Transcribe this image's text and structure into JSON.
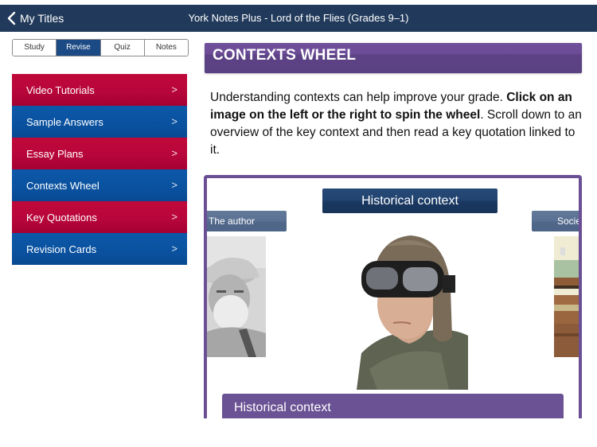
{
  "navbar": {
    "back_label": "My Titles",
    "title": "York Notes Plus - Lord of the Flies (Grades 9–1)"
  },
  "segments": [
    {
      "label": "Study",
      "active": false
    },
    {
      "label": "Revise",
      "active": true
    },
    {
      "label": "Quiz",
      "active": false
    },
    {
      "label": "Notes",
      "active": false
    }
  ],
  "menu": {
    "items": [
      {
        "label": "Video Tutorials",
        "color": "red",
        "arrow": ">"
      },
      {
        "label": "Sample Answers",
        "color": "blue",
        "arrow": ">"
      },
      {
        "label": "Essay Plans",
        "color": "red",
        "arrow": ">"
      },
      {
        "label": "Contexts Wheel",
        "color": "blue",
        "arrow": ">"
      },
      {
        "label": "Key Quotations",
        "color": "red",
        "arrow": ">"
      },
      {
        "label": "Revision Cards",
        "color": "blue",
        "arrow": ">"
      }
    ]
  },
  "content": {
    "heading": "CONTEXTS WHEEL",
    "intro_part1": "Understanding contexts can help improve your grade. ",
    "intro_bold": "Click on an image on the left or the right to spin the wheel",
    "intro_part2": ". Scroll down to an overview of the key context and then read a key quotation linked to it."
  },
  "wheel": {
    "center_title": "Historical context",
    "left_tab": "The author",
    "right_tab": "Society",
    "left_image": "author-portrait",
    "center_image": "young-pilot-with-goggles",
    "right_image": "classroom-desks",
    "banner": "Historical context"
  },
  "colors": {
    "navbar": "#213a5b",
    "segment_active": "#1c4a85",
    "menu_red": "#b8063a",
    "menu_blue": "#0a52a0",
    "header_purple": "#5d4385",
    "wheel_border": "#6b4f95",
    "wheel_title": "#1f406a",
    "side_tab": "#566e90"
  }
}
